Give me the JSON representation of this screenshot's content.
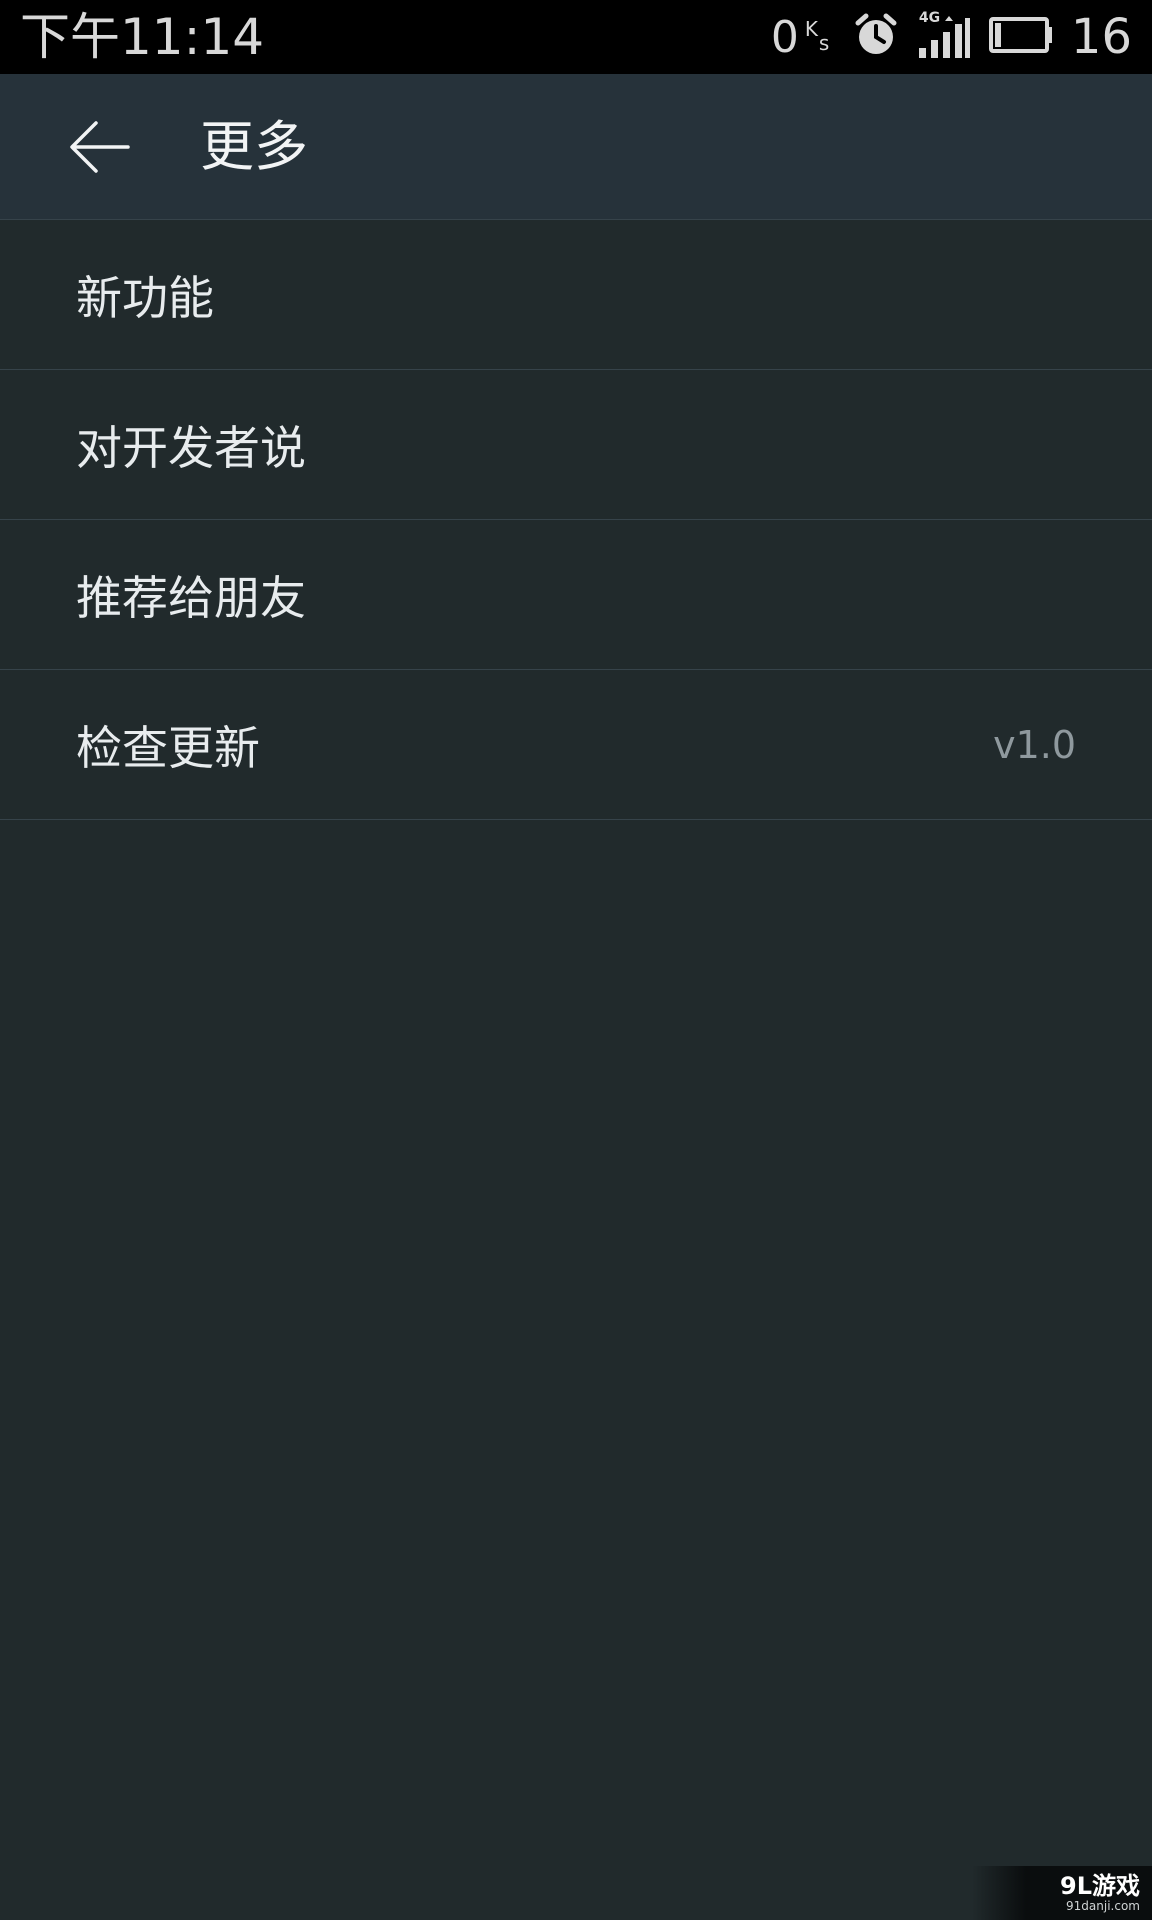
{
  "status_bar": {
    "time": "下午11:14",
    "net_speed_value": "0",
    "net_speed_unit_top": "K",
    "net_speed_unit_bottom": "s",
    "icons": [
      "alarm-icon",
      "signal-4g-icon",
      "battery-icon"
    ],
    "network_type": "4G",
    "battery_level": "16"
  },
  "app_bar": {
    "title": "更多",
    "back_icon": "arrow-left-icon"
  },
  "menu": {
    "items": [
      {
        "label": "新功能",
        "value": ""
      },
      {
        "label": "对开发者说",
        "value": ""
      },
      {
        "label": "推荐给朋友",
        "value": ""
      },
      {
        "label": "检查更新",
        "value": "v1.0"
      }
    ]
  },
  "watermark": {
    "main": "9L游戏",
    "sub": "91danji.com"
  },
  "colors": {
    "background": "#212a2c",
    "app_bar": "#26323a",
    "status_bar": "#000000",
    "divider": "#36434a",
    "text_primary": "#e8ecee",
    "text_secondary": "#8f999e"
  }
}
